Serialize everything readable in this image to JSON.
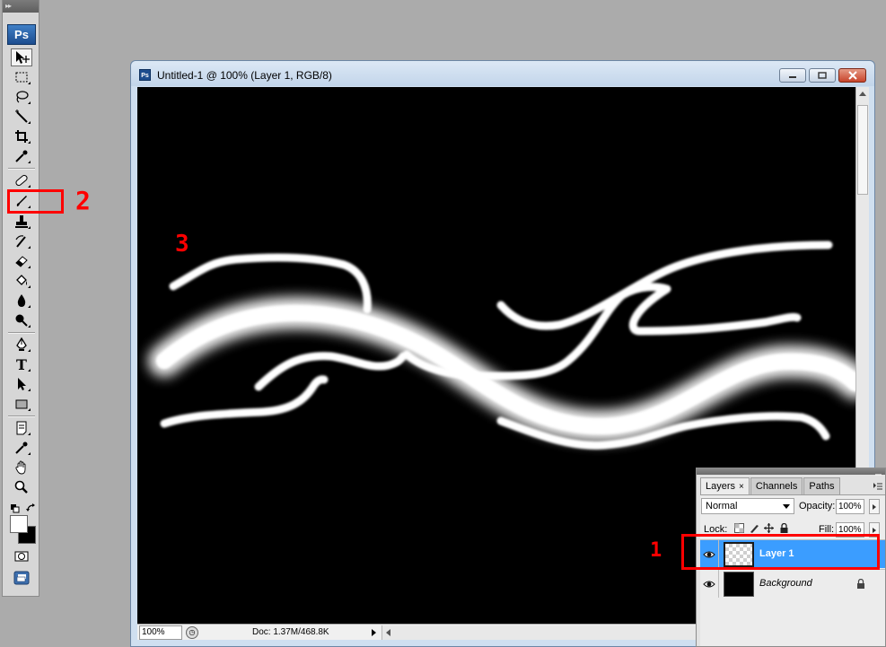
{
  "toolbox": {
    "logo": "Ps",
    "tools": [
      {
        "name": "move-tool-icon"
      },
      {
        "name": "marquee-tool-icon"
      },
      {
        "name": "lasso-tool-icon"
      },
      {
        "name": "magic-wand-tool-icon"
      },
      {
        "name": "crop-tool-icon"
      },
      {
        "name": "eyedropper-tool-icon"
      },
      {
        "name": "healing-brush-tool-icon"
      },
      {
        "name": "brush-tool-icon"
      },
      {
        "name": "clone-stamp-tool-icon"
      },
      {
        "name": "history-brush-tool-icon"
      },
      {
        "name": "eraser-tool-icon"
      },
      {
        "name": "paint-bucket-tool-icon"
      },
      {
        "name": "blur-tool-icon"
      },
      {
        "name": "dodge-tool-icon"
      },
      {
        "name": "pen-tool-icon"
      },
      {
        "name": "type-tool-icon"
      },
      {
        "name": "path-selection-tool-icon"
      },
      {
        "name": "rectangle-tool-icon"
      },
      {
        "name": "notes-tool-icon"
      },
      {
        "name": "color-sampler-tool-icon"
      },
      {
        "name": "hand-tool-icon"
      },
      {
        "name": "zoom-tool-icon"
      }
    ],
    "type_tool_glyph": "T",
    "foreground_color": "#ffffff",
    "background_color": "#000000"
  },
  "document": {
    "title": "Untitled-1 @ 100% (Layer 1, RGB/8)",
    "app_icon": "Ps",
    "zoom": "100%",
    "doc_size": "Doc: 1.37M/468.8K",
    "canvas_color": "#000000",
    "stroke_color": "#ffffff"
  },
  "layers_panel": {
    "tabs": [
      {
        "label": "Layers",
        "close": "×"
      },
      {
        "label": "Channels"
      },
      {
        "label": "Paths"
      }
    ],
    "blend_mode": "Normal",
    "opacity_label": "Opacity:",
    "opacity_value": "100%",
    "lock_label": "Lock:",
    "fill_label": "Fill:",
    "fill_value": "100%",
    "layers": [
      {
        "name": "Layer 1",
        "selected": true
      },
      {
        "name": "Background",
        "selected": false,
        "locked": true
      }
    ]
  },
  "annotations": {
    "color": "#ff0000",
    "labels": [
      "1",
      "2",
      "3"
    ]
  }
}
